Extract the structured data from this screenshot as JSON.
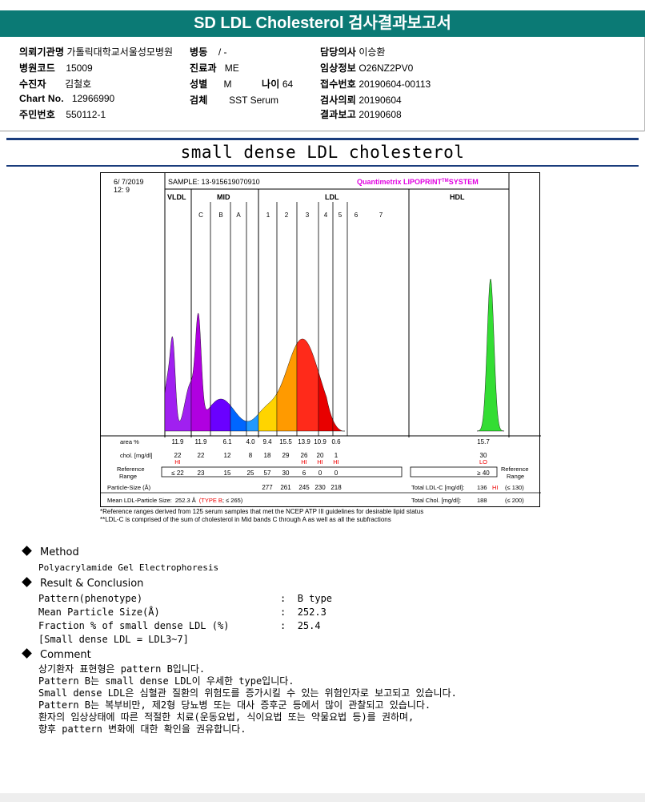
{
  "report_title": "SD LDL Cholesterol 검사결과보고서",
  "patient_info": {
    "hospital_label": "의뢰기관명",
    "hospital": "가톨릭대학교서울성모병원",
    "ward_label": "병동",
    "ward": "/ -",
    "doctor_label": "담당의사",
    "doctor": "이승환",
    "hospital_code_label": "병원코드",
    "hospital_code": "15009",
    "department_label": "진료과",
    "department": "ME",
    "clinical_info_label": "임상정보",
    "clinical_info": "O26NZ2PV0",
    "patient_label": "수진자",
    "patient": "김철호",
    "sex_label": "성별",
    "sex": "M",
    "age_label": "나이",
    "age": "64",
    "receipt_label": "접수번호",
    "receipt": "20190604-00113",
    "chart_no_label": "Chart No.",
    "chart_no": "12966990",
    "specimen_label": "검체",
    "specimen": "SST Serum",
    "request_date_label": "검사의뢰",
    "request_date": "20190604",
    "ssn_label": "주민번호",
    "ssn": "550112-1",
    "report_date_label": "결과보고",
    "report_date": "20190608"
  },
  "section_title": "small dense LDL cholesterol",
  "chart": {
    "date": "6/ 7/2019",
    "time": "12: 9",
    "sample": "SAMPLE:  13-915619070910",
    "brand": "Quantimetrix LIPOPRINT",
    "brand_tm": "TM",
    "brand_suffix": "SYSTEM",
    "groups": [
      "VLDL",
      "MID",
      "LDL",
      "HDL"
    ],
    "mid_bands": [
      "C",
      "B",
      "A"
    ],
    "ldl_bands": [
      "1",
      "2",
      "3",
      "4",
      "5",
      "6",
      "7"
    ],
    "area_label": "area %",
    "chol_label": "chol. [mg/dl]",
    "ref_label": "Reference Range",
    "ref_label_line1": "Reference",
    "ref_label_line2": "Range",
    "area_values": [
      "11.9",
      "11.9",
      "6.1",
      "4.0",
      "9.4",
      "15.5",
      "13.9",
      "10.9",
      "0.6",
      "15.7"
    ],
    "chol_values": [
      "22",
      "22",
      "12",
      "8",
      "18",
      "29",
      "26",
      "20",
      "1",
      "30"
    ],
    "flags": [
      "HI",
      "",
      "",
      "",
      "",
      "",
      "HI",
      "HI",
      "HI",
      "LO"
    ],
    "ref_values": [
      "≤ 22",
      "23",
      "15",
      "25",
      "57",
      "30",
      "6",
      "0",
      "0",
      "≥ 40"
    ],
    "particle_size_label": "Particle-Size (Å)",
    "particle_sizes": [
      "277",
      "261",
      "245",
      "230",
      "218"
    ],
    "total_ldl_label": "Total LDL-C [mg/dl]:",
    "total_ldl": "136",
    "total_ldl_flag": "HI",
    "total_ldl_ref": "(≤ 130)",
    "mean_size_label": "Mean LDL-Particle Size:",
    "mean_size": "252.3 Å",
    "mean_size_type": "(TYPE B",
    "mean_size_ref": "; ≤ 265)",
    "total_chol_label": "Total Chol. [mg/dl]:",
    "total_chol": "188",
    "total_chol_ref": "(≤ 200)",
    "note1": "*Reference ranges derived from 125 serum samples that met the NCEP ATP III guidelines for desirable lipid status",
    "note2": "**LDL-C is comprised of the sum of cholesterol in Mid bands C through A as well as all the subfractions",
    "colors": {
      "vldl": "#a020f0",
      "c": "#b000e0",
      "b": "#6a00ff",
      "a": "#0066ff",
      "b1": "#0088ff",
      "b2": "#ffcc00",
      "b3": "#ff9900",
      "b4": "#ff3300",
      "b5": "#ee0000",
      "hdl": "#33dd33",
      "brand": "#e000e0",
      "hi": "#ee0000"
    }
  },
  "method": {
    "heading": "Method",
    "text": "Polyacrylamide Gel Electrophoresis"
  },
  "result": {
    "heading": "Result & Conclusion",
    "rows": [
      {
        "label": "Pattern(phenotype)",
        "value": "B type"
      },
      {
        "label": "Mean Particle Size(Å)",
        "value": "252.3"
      },
      {
        "label": "Fraction % of small dense LDL (%)",
        "value": "25.4"
      }
    ],
    "note": "[Small dense LDL = LDL3~7]"
  },
  "comment": {
    "heading": "Comment",
    "lines": [
      "상기환자 표현형은 pattern B입니다.",
      "Pattern B는 small dense LDL이 우세한 type입니다.",
      "Small dense LDL은 심혈관 질환의 위험도를 증가시킬 수 있는 위험인자로 보고되고 있습니다.",
      "Pattern B는 복부비만, 제2형 당뇨병 또는 대사 증후군 등에서 많이 관찰되고 있습니다.",
      "환자의 임상상태에 따른 적절한 치료(운동요법, 식이요법 또는 약물요법 등)를 권하며,",
      "향후 pattern 변화에 대한 확인을 권유합니다."
    ]
  }
}
